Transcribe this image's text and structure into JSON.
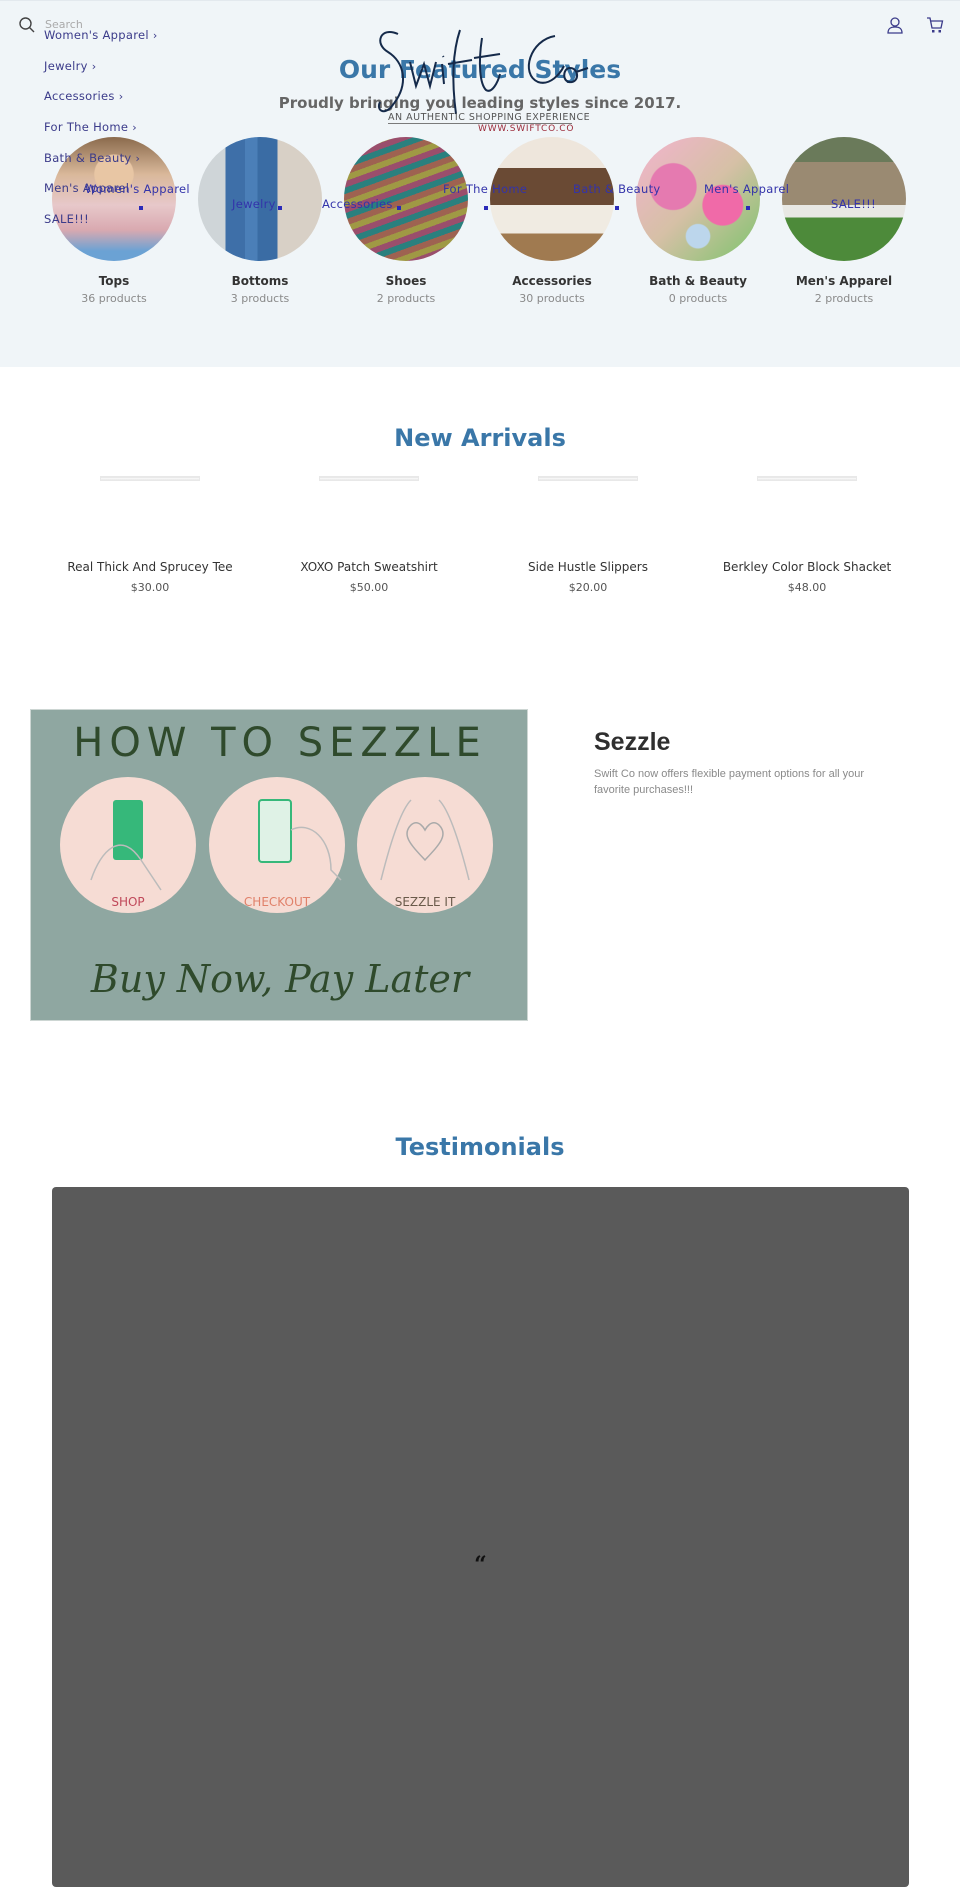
{
  "header": {
    "search_placeholder": "Search",
    "icons": {
      "search": "search-icon",
      "account": "account-icon",
      "cart": "cart-icon"
    },
    "logo": {
      "brand": "Swift Co",
      "tagline": "AN AUTHENTIC SHOPPING EXPERIENCE",
      "url_text": "WWW.SWIFTCO.CO"
    }
  },
  "side_nav": [
    {
      "label": "Women's Apparel",
      "chevron": "›"
    },
    {
      "label": "Jewelry",
      "chevron": "›"
    },
    {
      "label": "Accessories",
      "chevron": "›"
    },
    {
      "label": "For The Home",
      "chevron": "›"
    },
    {
      "label": "Bath & Beauty",
      "chevron": "›"
    },
    {
      "label": "Men's Apparel",
      "chevron": ""
    },
    {
      "label": "SALE!!!",
      "chevron": ""
    }
  ],
  "overlay_nav": [
    {
      "label": "Women's Apparel"
    },
    {
      "label": "Jewelry"
    },
    {
      "label": "Accessories"
    },
    {
      "label": "For The Home"
    },
    {
      "label": "Bath & Beauty"
    },
    {
      "label": "Men's Apparel"
    },
    {
      "label": "SALE!!!"
    }
  ],
  "featured": {
    "title": "Our Featured Styles",
    "subtitle": "Proudly bringing you leading styles since 2017.",
    "collections": [
      {
        "name": "Tops",
        "count": "36 products"
      },
      {
        "name": "Bottoms",
        "count": "3 products"
      },
      {
        "name": "Shoes",
        "count": "2 products"
      },
      {
        "name": "Accessories",
        "count": "30 products"
      },
      {
        "name": "Bath & Beauty",
        "count": "0 products"
      },
      {
        "name": "Men's Apparel",
        "count": "2 products"
      }
    ]
  },
  "new_arrivals": {
    "title": "New Arrivals",
    "products": [
      {
        "name": "Real Thick And Sprucey Tee",
        "price": "$30.00"
      },
      {
        "name": "XOXO Patch Sweatshirt",
        "price": "$50.00"
      },
      {
        "name": "Side Hustle Slippers",
        "price": "$20.00"
      },
      {
        "name": "Berkley Color Block Shacket",
        "price": "$48.00"
      }
    ]
  },
  "sezzle": {
    "heading": "Sezzle",
    "text": "Swift Co now offers flexible payment options for all your favorite purchases!!!",
    "image": {
      "title": "HOW TO SEZZLE",
      "steps": [
        "SHOP",
        "CHECKOUT",
        "SEZZLE IT"
      ],
      "footer": "Buy Now, Pay Later"
    }
  },
  "testimonials": {
    "title": "Testimonials",
    "quote_mark": "“"
  },
  "colors": {
    "accent_blue": "#3a77a8",
    "nav_text": "#3b3b8a",
    "top_band": "#f0f5f8",
    "testimonial_bg": "#5a5a5a",
    "sezzle_bg": "#8fa7a1"
  }
}
